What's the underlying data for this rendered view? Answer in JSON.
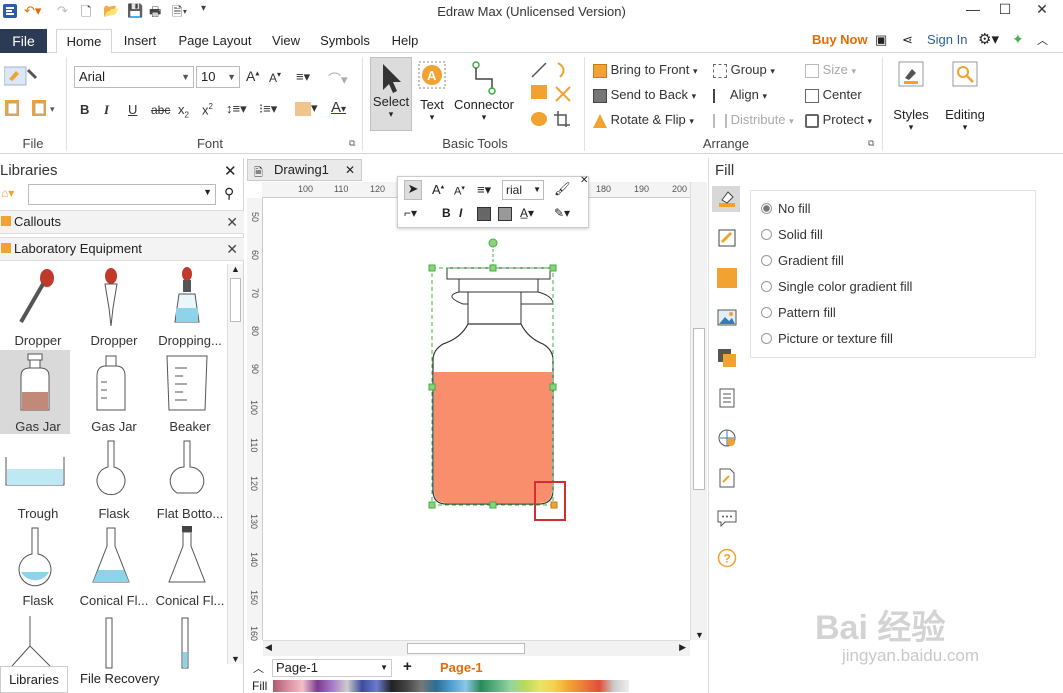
{
  "app": {
    "title": "Edraw Max (Unlicensed Version)"
  },
  "window": {
    "minimize": "—",
    "maximize": "☐",
    "close": "✕"
  },
  "tabs": {
    "file": "File",
    "items": [
      "Home",
      "Insert",
      "Page Layout",
      "View",
      "Symbols",
      "Help"
    ],
    "active": "Home",
    "buy_now": "Buy Now",
    "sign_in": "Sign In"
  },
  "ribbon": {
    "groups": {
      "file": "File",
      "font": "Font",
      "basic_tools": "Basic Tools",
      "arrange": "Arrange"
    },
    "font": {
      "family": "Arial",
      "size": "10"
    },
    "basic_tools": {
      "select": "Select",
      "text": "Text",
      "connector": "Connector"
    },
    "arrange": {
      "bring_to_front": "Bring to Front",
      "send_to_back": "Send to Back",
      "rotate_flip": "Rotate & Flip",
      "group": "Group",
      "align": "Align",
      "distribute": "Distribute",
      "size": "Size",
      "center": "Center",
      "protect": "Protect"
    },
    "styles": "Styles",
    "editing": "Editing"
  },
  "libraries": {
    "title": "Libraries",
    "search_placeholder": "",
    "sections": [
      "Callouts",
      "Laboratory Equipment"
    ],
    "shapes": [
      "Dropper",
      "Dropper",
      "Dropping...",
      "Gas Jar",
      "Gas Jar",
      "Beaker",
      "Trough",
      "Flask",
      "Flat Botto...",
      "Flask",
      "Conical Fl...",
      "Conical Fl..."
    ],
    "selected": "Gas Jar",
    "bottom_tabs": [
      "Libraries",
      "File Recovery"
    ]
  },
  "document": {
    "tab": "Drawing1",
    "ruler_h": [
      "100",
      "110",
      "120",
      "180",
      "190",
      "200"
    ],
    "ruler_v": [
      "50",
      "60",
      "70",
      "80",
      "90",
      "100",
      "110",
      "120",
      "130",
      "140",
      "150",
      "160"
    ],
    "font_mini": "rial",
    "page_select": "Page-1",
    "page_tab": "Page-1",
    "fill_label": "Fill"
  },
  "fill_panel": {
    "title": "Fill",
    "options": [
      "No fill",
      "Solid fill",
      "Gradient fill",
      "Single color gradient fill",
      "Pattern fill",
      "Picture or texture fill"
    ],
    "selected": "No fill"
  },
  "colors": {
    "accent": "#e36c09",
    "file_tab": "#2b3a55",
    "jar_fill": "#f88e6c",
    "selection": "#3cb043",
    "highlight_box": "#d32f2f"
  },
  "watermark": {
    "main": "Bai 经验",
    "sub": "jingyan.baidu.com"
  }
}
